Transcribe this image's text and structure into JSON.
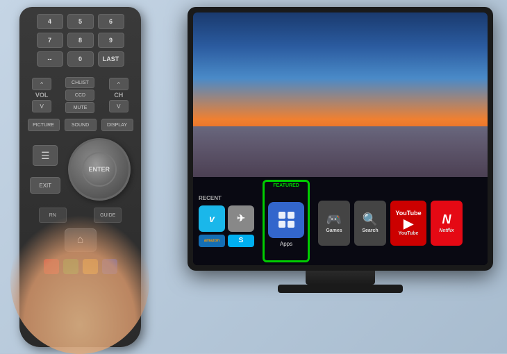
{
  "scene": {
    "background_color": "#b8c8d8"
  },
  "remote": {
    "buttons": {
      "row1": [
        "4",
        "5",
        "6"
      ],
      "row2": [
        "7",
        "8",
        "9"
      ],
      "row3": [
        "--",
        "0",
        "LAST"
      ],
      "vol_up": "^",
      "vol_label": "VOL",
      "vol_down": "V",
      "ch_up": "^",
      "ch_label": "CH",
      "ch_down": "V",
      "chlist": "CHLIST",
      "ccd": "CCD",
      "mute": "MUTE",
      "picture": "PICTURE",
      "sound": "SOUND",
      "display": "DISPLAY",
      "menu": "☰",
      "exit": "EXIT",
      "enter": "ENTER",
      "guide": "GUIDE",
      "home": "⌂"
    },
    "color_buttons": [
      "#ff0000",
      "#00aa00",
      "#ffcc00",
      "#0000cc"
    ]
  },
  "tv": {
    "menu": {
      "recent_label": "RECENT",
      "featured_label": "FEATURED",
      "apps_label": "Apps",
      "sections": [
        {
          "label": "RECENT",
          "apps": [
            {
              "name": "Vimeo",
              "color": "#1ab7ea",
              "symbol": "v"
            },
            {
              "name": "",
              "color": "#aaaaaa",
              "symbol": "✈"
            },
            {
              "name": "amazon",
              "color": "#ff9900",
              "symbol": "amazon"
            },
            {
              "name": "Skype",
              "color": "#00aff0",
              "symbol": "S"
            }
          ]
        },
        {
          "label": "FEATURED",
          "apps": [
            {
              "name": "Apps",
              "color": "#3366cc",
              "symbol": "apps"
            }
          ]
        },
        {
          "label": "",
          "apps": [
            {
              "name": "Games",
              "color": "#555555",
              "symbol": "🎮"
            },
            {
              "name": "Search",
              "color": "#555555",
              "symbol": "🔍"
            },
            {
              "name": "YouTube",
              "color": "#ff0000",
              "symbol": "▶"
            },
            {
              "name": "Netflix",
              "color": "#e50914",
              "symbol": "N"
            }
          ]
        }
      ]
    }
  }
}
